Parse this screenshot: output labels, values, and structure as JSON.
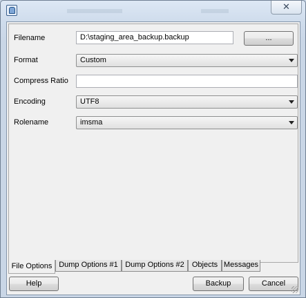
{
  "titlebar": {
    "close_glyph": "✕"
  },
  "form": {
    "filename_label": "Filename",
    "filename_value": "D:\\staging_area_backup.backup",
    "browse_label": "...",
    "format_label": "Format",
    "format_value": "Custom",
    "compress_label": "Compress Ratio",
    "compress_value": "",
    "encoding_label": "Encoding",
    "encoding_value": "UTF8",
    "rolename_label": "Rolename",
    "rolename_value": "imsma"
  },
  "tabs": [
    "File Options",
    "Dump Options #1",
    "Dump Options #2",
    "Objects",
    "Messages"
  ],
  "buttons": {
    "help": "Help",
    "backup": "Backup",
    "cancel": "Cancel"
  }
}
